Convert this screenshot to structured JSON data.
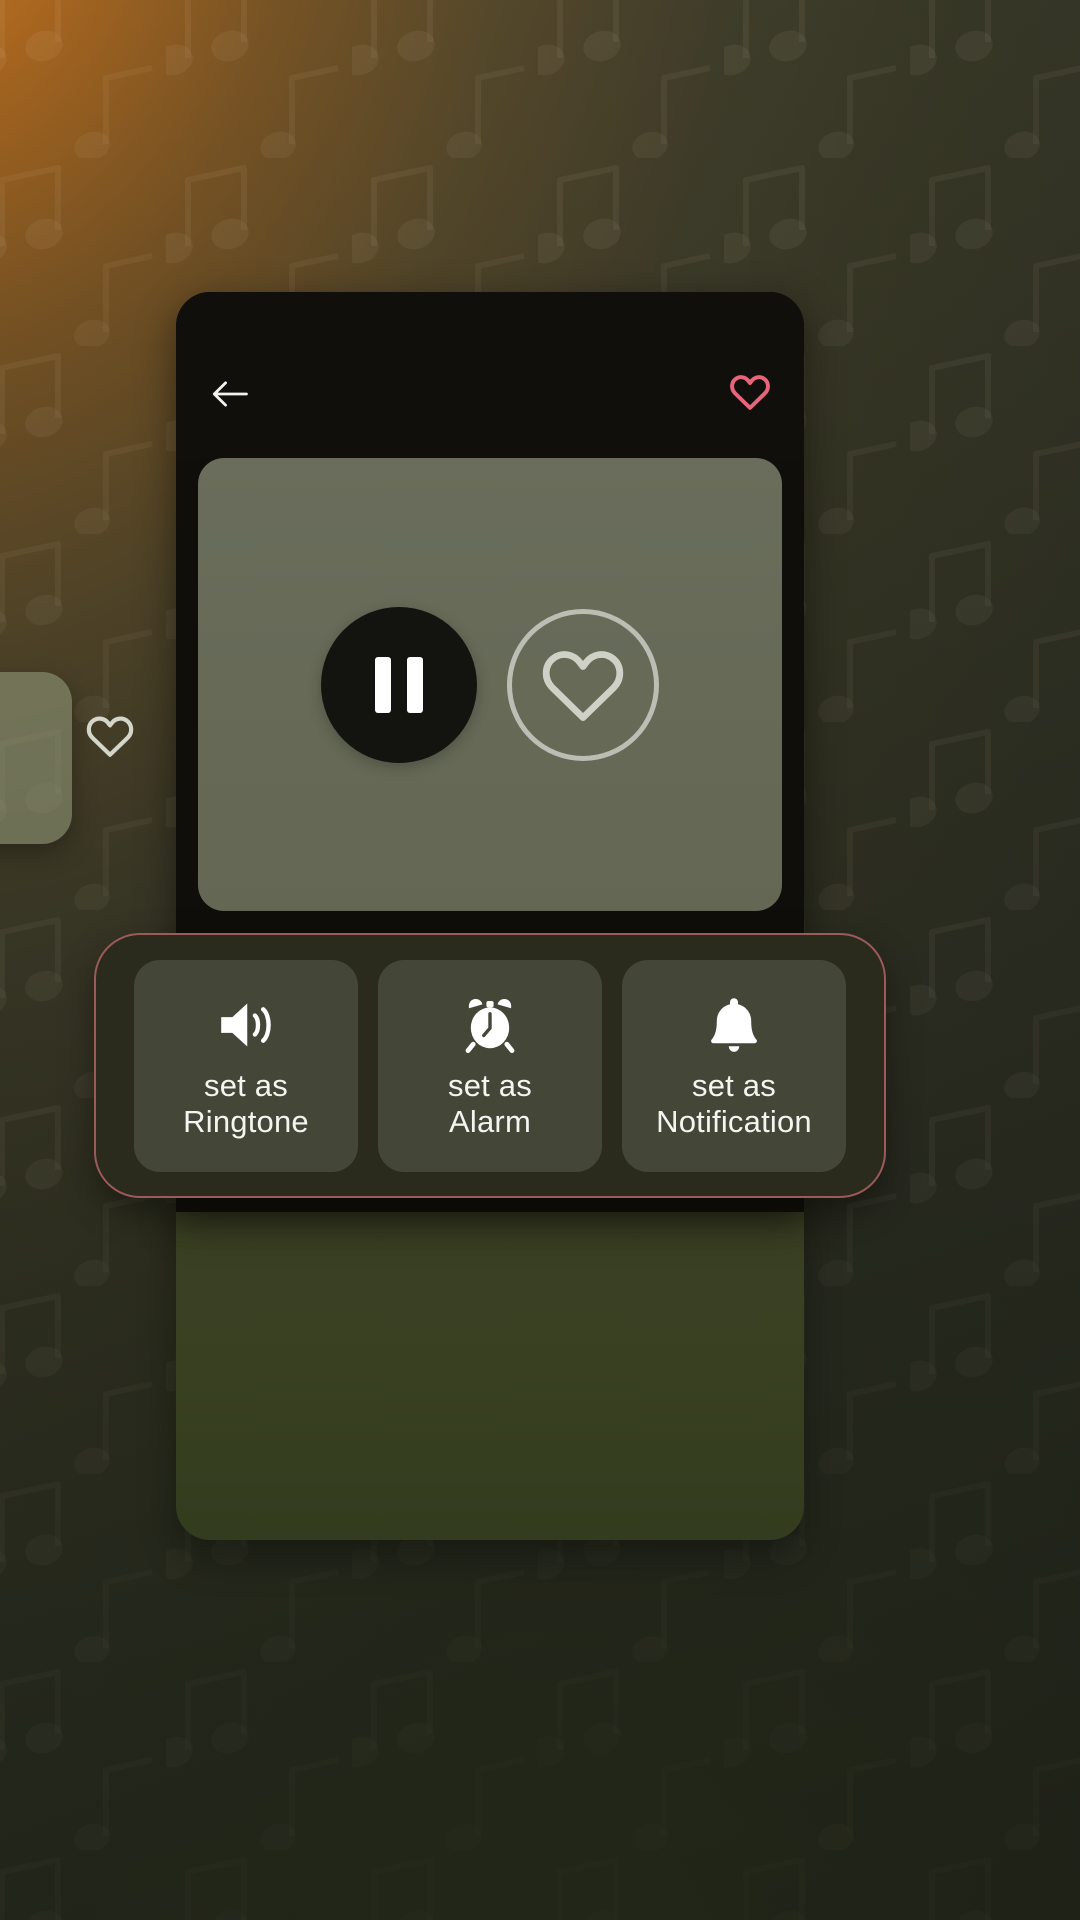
{
  "wallpaper": {
    "pattern_icon": "music-note-icon",
    "gradient_from": "#c67a28",
    "gradient_to": "#34362a"
  },
  "peek_card": {
    "icon": "heart-outline-icon"
  },
  "player_card": {
    "topbar": {
      "back_icon": "arrow-left-icon",
      "favorite_icon": "heart-outline-icon",
      "favorite_color": "#e8647a"
    },
    "artwork": {
      "background_color": "#666a57",
      "play_pause": {
        "icon": "pause-icon",
        "state": "playing",
        "button_color": "#131310"
      },
      "like": {
        "icon": "heart-outline-icon",
        "ring_color": "#bcbeb4"
      }
    }
  },
  "action_bar": {
    "border_color": "#9c5a5a",
    "background_color": "#2a2a1d",
    "buttons": [
      {
        "icon": "speaker-volume-icon",
        "label": "set as\nRingtone"
      },
      {
        "icon": "alarm-clock-icon",
        "label": "set as\nAlarm"
      },
      {
        "icon": "bell-icon",
        "label": "set as\nNotification"
      }
    ]
  }
}
